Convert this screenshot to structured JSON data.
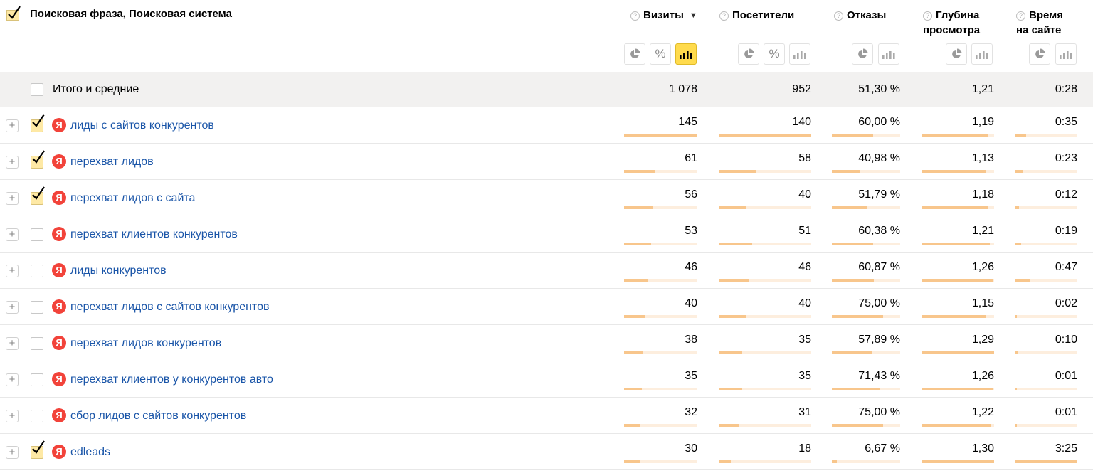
{
  "header": {
    "dimension_title": "Поисковая фраза, Поисковая система",
    "columns": [
      {
        "key": "visits",
        "label": "Визиты",
        "sorted": true,
        "sort_icon": "▼"
      },
      {
        "key": "visitors",
        "label": "Посетители"
      },
      {
        "key": "bounce",
        "label": "Отказы"
      },
      {
        "key": "depth",
        "label_line1": "Глубина",
        "label_line2": "просмотра"
      },
      {
        "key": "time",
        "label_line1": "Время",
        "label_line2": "на сайте"
      }
    ],
    "help_glyph": "?"
  },
  "view_buttons": {
    "visits": [
      "pie-chart-icon",
      "percent-icon",
      "bar-chart-icon"
    ],
    "visitors": [
      "pie-chart-icon",
      "percent-icon",
      "bar-chart-icon"
    ],
    "bounce": [
      "pie-chart-icon",
      "bar-chart-icon"
    ],
    "depth": [
      "pie-chart-icon",
      "bar-chart-icon"
    ],
    "time": [
      "pie-chart-icon",
      "bar-chart-icon"
    ],
    "active": "visits.bar-chart-icon",
    "percent_glyph": "%"
  },
  "totals": {
    "label": "Итого и средние",
    "visits": "1 078",
    "visitors": "952",
    "bounce": "51,30 %",
    "depth": "1,21",
    "time": "0:28"
  },
  "rows": [
    {
      "phrase": "лиды с сайтов конкурентов",
      "checked": true,
      "visits": "145",
      "visitors": "140",
      "bounce": "60,00 %",
      "depth": "1,19",
      "time": "0:35",
      "level": {
        "visits": 1.0,
        "visitors": 1.0,
        "bounce": 0.6,
        "depth": 0.92,
        "time": 0.17
      }
    },
    {
      "phrase": "перехват лидов",
      "checked": true,
      "visits": "61",
      "visitors": "58",
      "bounce": "40,98 %",
      "depth": "1,13",
      "time": "0:23",
      "level": {
        "visits": 0.42,
        "visitors": 0.41,
        "bounce": 0.41,
        "depth": 0.88,
        "time": 0.11
      }
    },
    {
      "phrase": "перехват лидов с сайта",
      "checked": true,
      "visits": "56",
      "visitors": "40",
      "bounce": "51,79 %",
      "depth": "1,18",
      "time": "0:12",
      "level": {
        "visits": 0.39,
        "visitors": 0.29,
        "bounce": 0.52,
        "depth": 0.91,
        "time": 0.06
      }
    },
    {
      "phrase": "перехват клиентов конкурентов",
      "checked": false,
      "visits": "53",
      "visitors": "51",
      "bounce": "60,38 %",
      "depth": "1,21",
      "time": "0:19",
      "level": {
        "visits": 0.37,
        "visitors": 0.36,
        "bounce": 0.6,
        "depth": 0.94,
        "time": 0.09
      }
    },
    {
      "phrase": "лиды конкурентов",
      "checked": false,
      "visits": "46",
      "visitors": "46",
      "bounce": "60,87 %",
      "depth": "1,26",
      "time": "0:47",
      "level": {
        "visits": 0.32,
        "visitors": 0.33,
        "bounce": 0.61,
        "depth": 0.98,
        "time": 0.23
      }
    },
    {
      "phrase": "перехват лидов с сайтов конкурентов",
      "checked": false,
      "visits": "40",
      "visitors": "40",
      "bounce": "75,00 %",
      "depth": "1,15",
      "time": "0:02",
      "level": {
        "visits": 0.28,
        "visitors": 0.29,
        "bounce": 0.75,
        "depth": 0.89,
        "time": 0.01
      }
    },
    {
      "phrase": "перехват лидов конкурентов",
      "checked": false,
      "visits": "38",
      "visitors": "35",
      "bounce": "57,89 %",
      "depth": "1,29",
      "time": "0:10",
      "level": {
        "visits": 0.26,
        "visitors": 0.25,
        "bounce": 0.58,
        "depth": 1.0,
        "time": 0.05
      }
    },
    {
      "phrase": "перехват клиентов у конкурентов авто",
      "checked": false,
      "visits": "35",
      "visitors": "35",
      "bounce": "71,43 %",
      "depth": "1,26",
      "time": "0:01",
      "level": {
        "visits": 0.24,
        "visitors": 0.25,
        "bounce": 0.71,
        "depth": 0.98,
        "time": 0.005
      }
    },
    {
      "phrase": "сбор лидов с сайтов конкурентов",
      "checked": false,
      "visits": "32",
      "visitors": "31",
      "bounce": "75,00 %",
      "depth": "1,22",
      "time": "0:01",
      "level": {
        "visits": 0.22,
        "visitors": 0.22,
        "bounce": 0.75,
        "depth": 0.95,
        "time": 0.005
      }
    },
    {
      "phrase": "edleads",
      "checked": true,
      "visits": "30",
      "visitors": "18",
      "bounce": "6,67 %",
      "depth": "1,30",
      "time": "3:25",
      "level": {
        "visits": 0.21,
        "visitors": 0.13,
        "bounce": 0.07,
        "depth": 1.0,
        "time": 1.0
      }
    }
  ],
  "search_engine_icon": "yandex-logo-icon",
  "search_engine_glyph": "Я",
  "expand_glyph": "+",
  "colors": {
    "link": "#1a55a8",
    "bar_fill": "#f8c68c",
    "bar_track": "#fdeede",
    "checkbox_checked": "#fee9a5",
    "active_button": "#ffdb4d",
    "yandex_red": "#f2433a",
    "totals_bg": "#f2f1f0"
  }
}
